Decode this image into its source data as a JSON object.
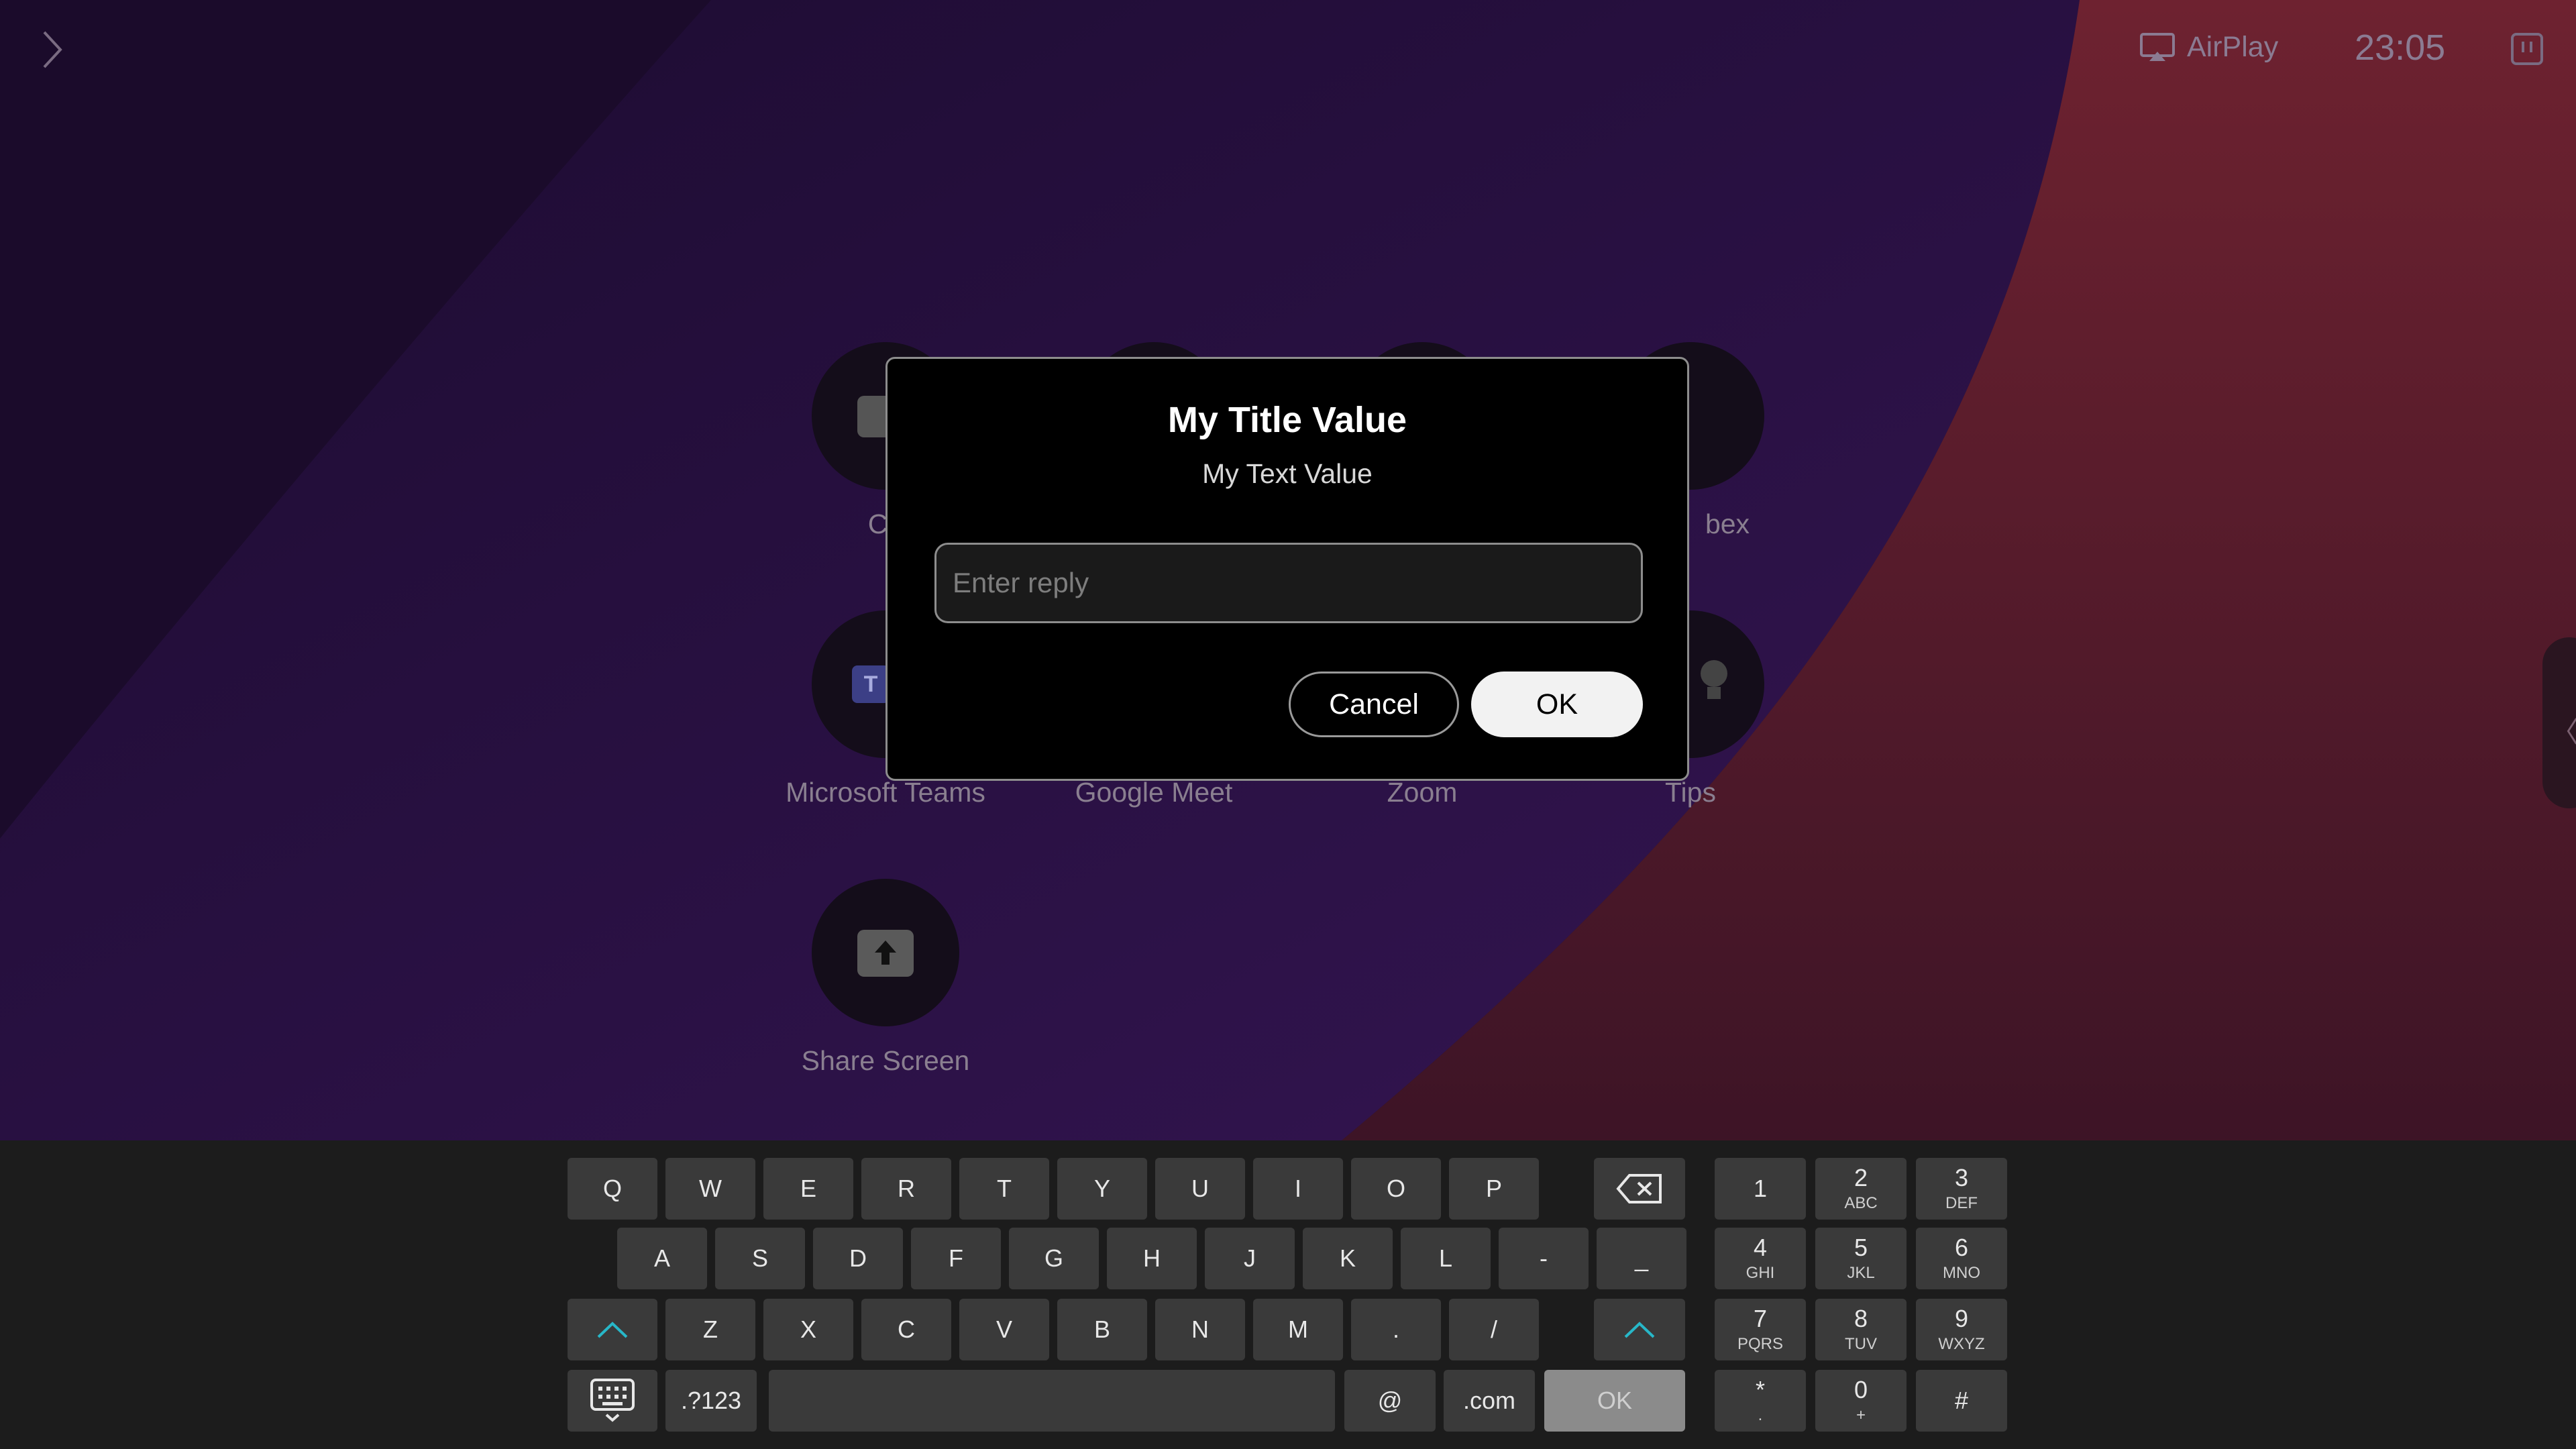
{
  "topbar": {
    "airplay_label": "AirPlay",
    "time": "23:05"
  },
  "apps": [
    {
      "label": "Ca"
    },
    {
      "label": "bex"
    },
    {
      "label": "Microsoft Teams"
    },
    {
      "label": "Google Meet"
    },
    {
      "label": "Zoom"
    },
    {
      "label": "Tips"
    },
    {
      "label": "Share Screen"
    }
  ],
  "dialog": {
    "title": "My Title Value",
    "text": "My Text Value",
    "input_placeholder": "Enter reply",
    "input_value": "",
    "cancel_label": "Cancel",
    "ok_label": "OK"
  },
  "keyboard": {
    "row1": [
      "Q",
      "W",
      "E",
      "R",
      "T",
      "Y",
      "U",
      "I",
      "O",
      "P"
    ],
    "row2": [
      "A",
      "S",
      "D",
      "F",
      "G",
      "H",
      "J",
      "K",
      "L",
      "-",
      "_"
    ],
    "row3": [
      "Z",
      "X",
      "C",
      "V",
      "B",
      "N",
      "M",
      ".",
      "/"
    ],
    "symbols_label": ".?123",
    "at_label": "@",
    "com_label": ".com",
    "ok_label": "OK",
    "numpad": [
      {
        "n": "1",
        "s": ""
      },
      {
        "n": "2",
        "s": "ABC"
      },
      {
        "n": "3",
        "s": "DEF"
      },
      {
        "n": "4",
        "s": "GHI"
      },
      {
        "n": "5",
        "s": "JKL"
      },
      {
        "n": "6",
        "s": "MNO"
      },
      {
        "n": "7",
        "s": "PQRS"
      },
      {
        "n": "8",
        "s": "TUV"
      },
      {
        "n": "9",
        "s": "WXYZ"
      },
      {
        "n": "*",
        "s": "."
      },
      {
        "n": "0",
        "s": "+"
      },
      {
        "n": "#",
        "s": ""
      }
    ]
  },
  "colors": {
    "accent": "#27b7c8",
    "bg_purple": "#2a0f47",
    "bg_red": "#5c1a24"
  }
}
